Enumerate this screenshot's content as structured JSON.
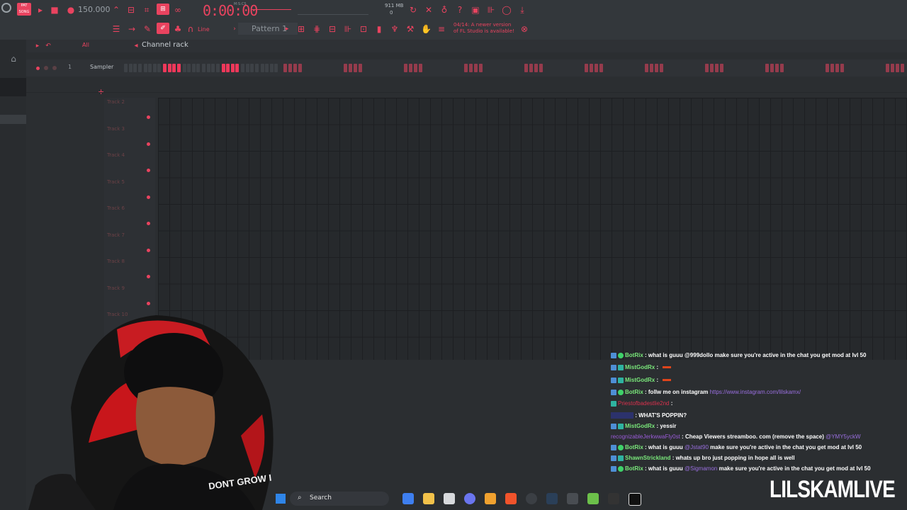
{
  "toolbar": {
    "mode_badge": "PAT SONG",
    "tempo": "150.000",
    "timecode": "0:00:00",
    "timecode_unit": "M:S:CS",
    "memory": "911 MB",
    "cpu_count": "0",
    "pattern": "Pattern 1",
    "snap": "Line",
    "news": "04/14: A newer version of FL Studio is available!"
  },
  "channel_rack": {
    "filter": "All",
    "title": "Channel rack",
    "channel_number": "1",
    "channel_name": "Sampler"
  },
  "playlist": {
    "tracks": [
      "Track 2",
      "Track 3",
      "Track 4",
      "Track 5",
      "Track 6",
      "Track 7",
      "Track 8",
      "Track 9",
      "Track 10"
    ]
  },
  "chat": {
    "lines": [
      {
        "user": "BotRix",
        "text": ": what is guuu @999dollo make sure you're active in the chat you get mod at lvl 50"
      },
      {
        "user": "MistGodRx",
        "text": ":"
      },
      {
        "user": "MistGodRx",
        "text": ":"
      },
      {
        "user": "BotRix",
        "text": ": follw me on instagram",
        "link": "https://www.instagram.com/lilskamx/"
      },
      {
        "user": "Priestofbadestlie2nd",
        "text": ":"
      },
      {
        "user": "",
        "text": ": WHAT'S POPPIN?"
      },
      {
        "user": "MistGodRx",
        "text": ": yessir"
      },
      {
        "user": "recognizableJerkwwaFly0st",
        "text": ": Cheap Viewers streamboo. com (remove the space)",
        "link": "@YMY5yckW"
      },
      {
        "user": "BotRix",
        "text": ": what is guuu",
        "mention": "@Jstat90",
        "text2": "make sure you're active in the chat you get mod at lvl 50"
      },
      {
        "user": "ShawnStrickland",
        "text": ": whats up bro just popping in hope all is well"
      },
      {
        "user": "BotRix",
        "text": ": what is guuu",
        "mention": "@Sigmamon",
        "text2": "make sure you're active in the chat you get mod at lvl 50"
      }
    ]
  },
  "taskbar": {
    "search": "Search"
  },
  "webcam": {
    "shirt_text": "DONT GROW I"
  },
  "watermark": "LILSKAMLIVE",
  "colors": {
    "accent": "#e9435f",
    "bg": "#2b2e31"
  }
}
